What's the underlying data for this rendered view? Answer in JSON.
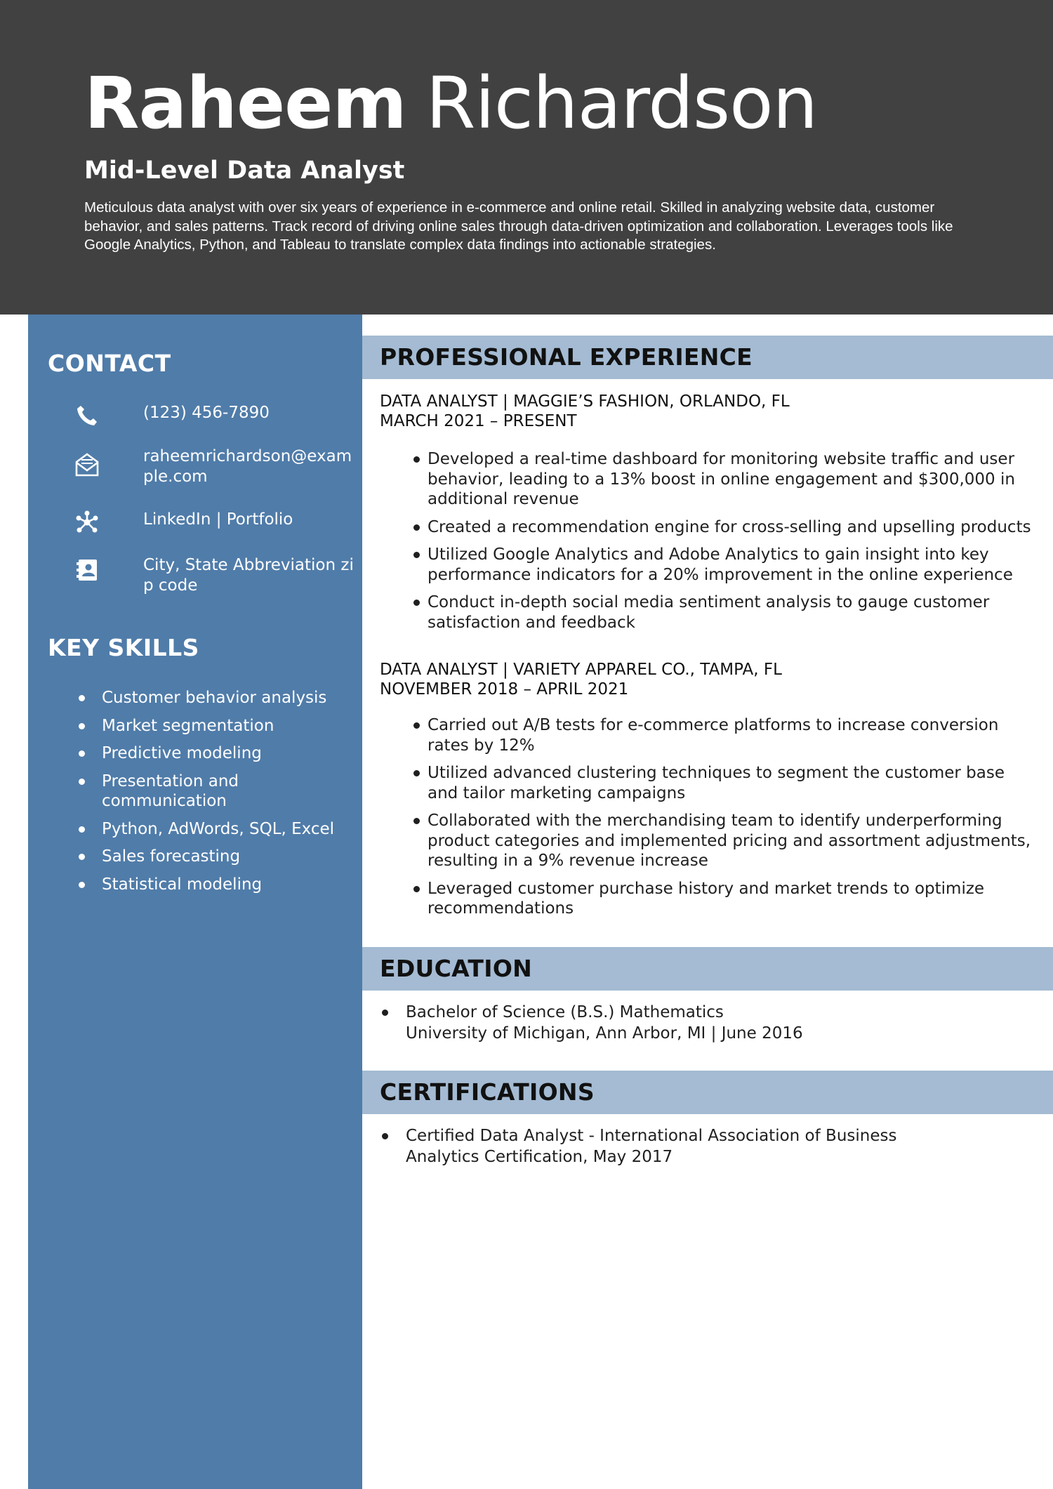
{
  "header": {
    "first_name": "Raheem",
    "last_name": "Richardson",
    "title": "Mid-Level Data Analyst",
    "summary": "Meticulous data analyst with over six years of experience in e-commerce and online retail. Skilled in analyzing website data, customer behavior, and sales patterns. Track record of driving online sales through data-driven optimization and collaboration. Leverages tools like Google Analytics, Python, and Tableau to translate complex data findings into actionable strategies."
  },
  "contact": {
    "heading": "CONTACT",
    "phone": "(123) 456-7890",
    "email": "raheemrichardson@example.com",
    "links": "LinkedIn | Portfolio",
    "address": "City, State Abbreviation zip code",
    "icons": [
      "phone-icon",
      "envelope-icon",
      "network-icon",
      "contact-card-icon"
    ]
  },
  "skills": {
    "heading": "KEY SKILLS",
    "items": [
      "Customer behavior analysis",
      "Market segmentation",
      "Predictive modeling",
      "Presentation and communication",
      "Python, AdWords, SQL, Excel",
      "Sales forecasting",
      "Statistical modeling"
    ]
  },
  "experience": {
    "heading": "PROFESSIONAL EXPERIENCE",
    "jobs": [
      {
        "title": "DATA ANALYST | MAGGIE’S FASHION, ORLANDO, FL",
        "dates": "MARCH 2021 – PRESENT",
        "bullets": [
          "Developed a real-time dashboard for monitoring website traffic and user behavior, leading to a 13% boost in online engagement and $300,000 in additional revenue",
          "Created a recommendation engine for cross-selling and upselling products",
          "Utilized Google Analytics and Adobe Analytics to gain insight into key performance indicators for a 20% improvement in the online experience",
          "Conduct in-depth social media sentiment analysis to gauge customer satisfaction and feedback"
        ]
      },
      {
        "title": "DATA ANALYST | VARIETY APPAREL CO., TAMPA, FL",
        "dates": "NOVEMBER 2018 – APRIL 2021",
        "bullets": [
          "Carried out A/B tests for e-commerce platforms to increase conversion rates by 12%",
          "Utilized advanced clustering techniques to segment the customer base and tailor marketing campaigns",
          "Collaborated with the merchandising team to identify underperforming product categories and implemented pricing and assortment adjustments, resulting in a 9% revenue increase",
          "Leveraged customer purchase history and market trends to optimize recommendations"
        ]
      }
    ]
  },
  "education": {
    "heading": "EDUCATION",
    "degree": "Bachelor of Science (B.S.) Mathematics",
    "school": "University of Michigan, Ann Arbor, MI | June 2016"
  },
  "certifications": {
    "heading": "CERTIFICATIONS",
    "item": "Certified Data Analyst - International Association of Business Analytics Certification, May 2017"
  },
  "colors": {
    "header_bg": "#414141",
    "sidebar_bg": "#507ca9",
    "section_bar_bg": "#a4bbd3"
  }
}
